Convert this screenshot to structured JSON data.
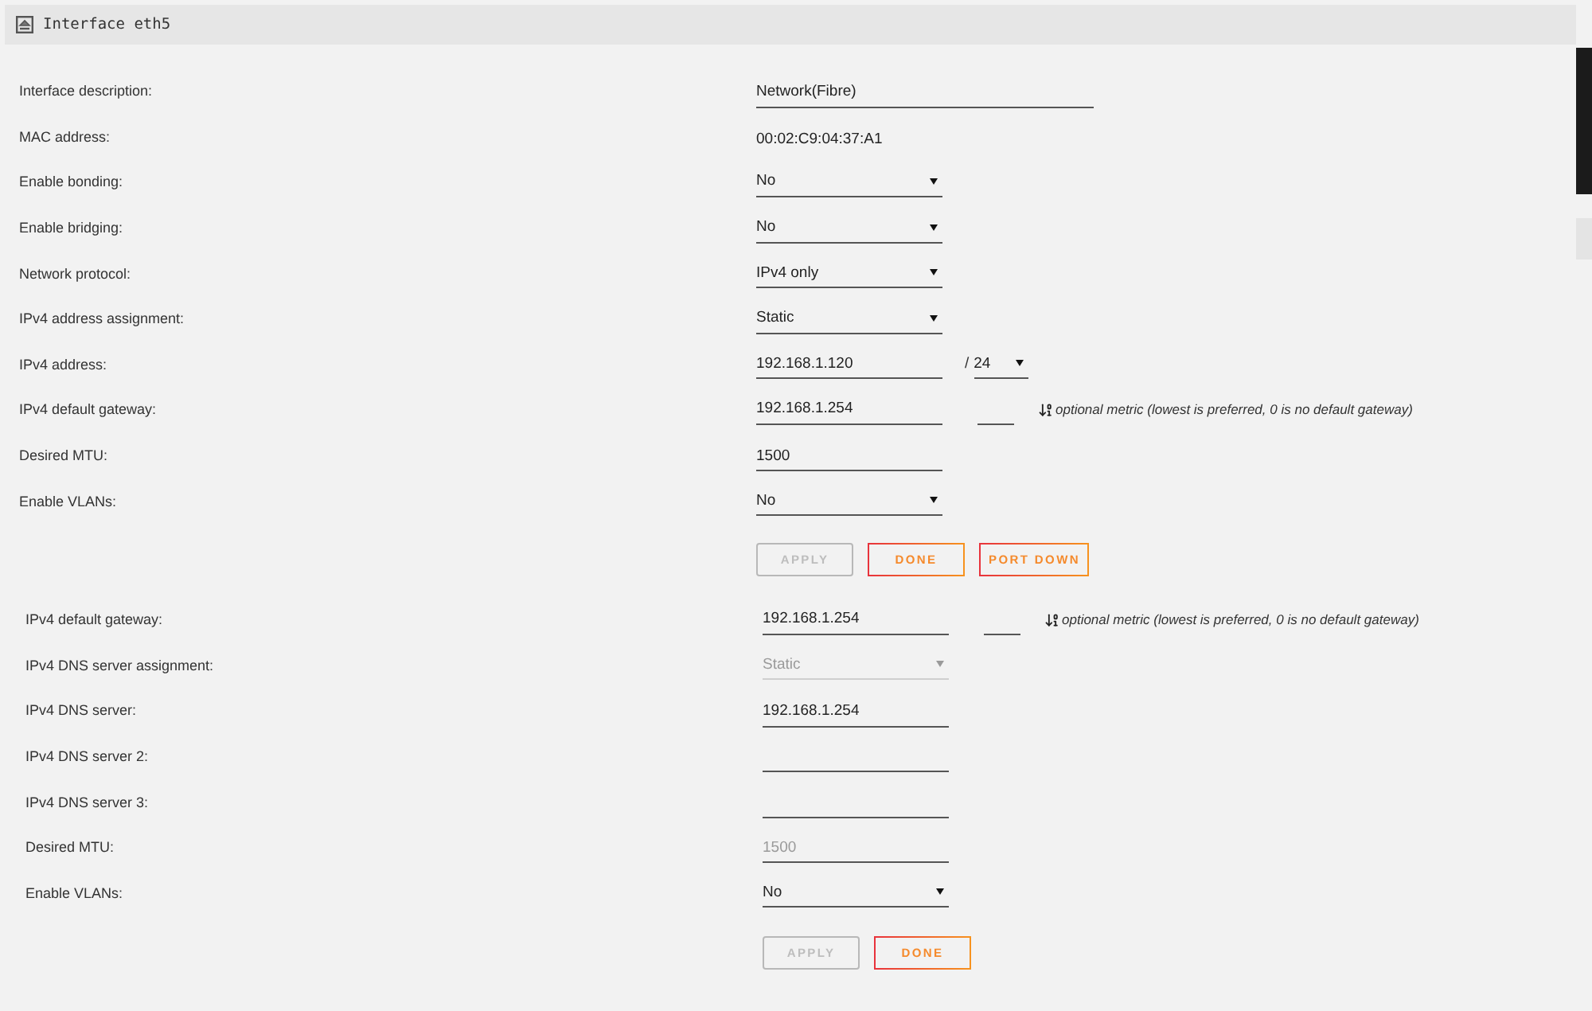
{
  "header": {
    "title": "Interface eth5"
  },
  "section_1": {
    "rows": [
      {
        "kind": "long_text",
        "label": "Interface description:",
        "value": "Network(Fibre)",
        "disabled": false
      },
      {
        "kind": "static",
        "label": "MAC address:",
        "value": "00:02:C9:04:37:A1",
        "disabled": false
      },
      {
        "kind": "select",
        "label": "Enable bonding:",
        "value": "No",
        "disabled": false
      },
      {
        "kind": "select",
        "label": "Enable bridging:",
        "value": "No",
        "disabled": false
      },
      {
        "kind": "select",
        "label": "Network protocol:",
        "value": "IPv4 only",
        "disabled": false
      },
      {
        "kind": "select",
        "label": "IPv4 address assignment:",
        "value": "Static",
        "disabled": false
      },
      {
        "kind": "address",
        "label": "IPv4 address:",
        "value": "192.168.1.120",
        "separator": "/",
        "prefix": "24",
        "disabled": false
      },
      {
        "kind": "gateway",
        "label": "IPv4 default gateway:",
        "value": "192.168.1.254",
        "hint": "optional metric (lowest is preferred, 0 is no default gateway)",
        "disabled": false
      },
      {
        "kind": "text",
        "label": "Desired MTU:",
        "value": "1500",
        "disabled": false
      },
      {
        "kind": "select",
        "label": "Enable VLANs:",
        "value": "No",
        "disabled": false
      }
    ],
    "buttons": [
      {
        "label": "APPLY",
        "disabled": true
      },
      {
        "label": "DONE",
        "disabled": false
      },
      {
        "label": "PORT DOWN",
        "disabled": false
      }
    ]
  },
  "section_2": {
    "rows": [
      {
        "kind": "gateway",
        "label": "IPv4 default gateway:",
        "value": "192.168.1.254",
        "hint": "optional metric (lowest is preferred, 0 is no default gateway)",
        "disabled": false
      },
      {
        "kind": "select",
        "label": "IPv4 DNS server assignment:",
        "value": "Static",
        "disabled": true
      },
      {
        "kind": "text",
        "label": "IPv4 DNS server:",
        "value": "192.168.1.254",
        "disabled": false
      },
      {
        "kind": "text",
        "label": "IPv4 DNS server 2:",
        "disabled": false
      },
      {
        "kind": "text",
        "label": "IPv4 DNS server 3:",
        "disabled": false
      },
      {
        "kind": "text",
        "label": "Desired MTU:",
        "placeholder": "1500",
        "disabled": false
      },
      {
        "kind": "select",
        "label": "Enable VLANs:",
        "value": "No",
        "disabled": false
      }
    ],
    "buttons": [
      {
        "label": "APPLY",
        "disabled": true
      },
      {
        "label": "DONE",
        "disabled": false
      }
    ]
  }
}
